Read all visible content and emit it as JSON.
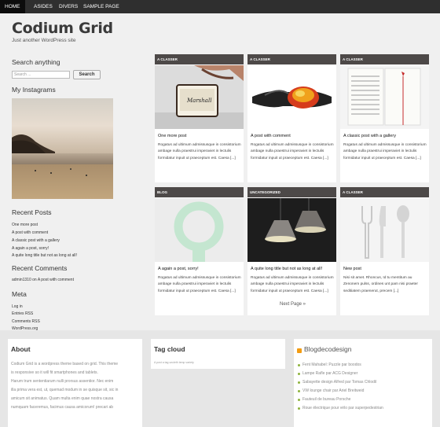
{
  "nav": [
    "Home",
    "Asides",
    "Divers",
    "Sample Page"
  ],
  "site": {
    "title": "Codium Grid",
    "tagline": "Just another WordPress site"
  },
  "sidebar": {
    "search": {
      "heading": "Search anything",
      "placeholder": "Search ...",
      "button": "Search"
    },
    "instagram": {
      "heading": "My Instagrams"
    },
    "recent_posts": {
      "heading": "Recent Posts",
      "items": [
        "One more post",
        "A post with comment",
        "A classic post with a gallery",
        "A again a post, sorry!",
        "A quite long title but not as long at all!"
      ]
    },
    "recent_comments": {
      "heading": "Recent Comments",
      "author": "admin1310",
      "on": "on",
      "post": "A post with comment"
    },
    "meta": {
      "heading": "Meta",
      "items": [
        "Log in",
        "Entries RSS",
        "Comments RSS",
        "WordPress.org"
      ]
    }
  },
  "posts": [
    {
      "category": "A classer",
      "title": "One more post",
      "excerpt": "Rogatus ad ultimum admissusque in consistorium ambage nulla praestrui imperaviet in lectulis formidatur inpuit ut praeceptum est. Caesa [...]"
    },
    {
      "category": "A classer",
      "title": "A post with comment",
      "excerpt": "Rogatus ad ultimum admissusque in consistorium ambage nulla praestrui imperaviet in lectulis formidatur inpuit ut praeceptum est. Caesa [...]"
    },
    {
      "category": "A classer",
      "title": "A classic post with a gallery",
      "excerpt": "Rogatus ad ultimum admissusque in consistorium ambage nulla praestrui imperaviet in lectulis formidatur inpuit ut praeceptum est. Caesa [...]"
    },
    {
      "category": "Blog",
      "title": "A again a post, sorry!",
      "excerpt": "Rogatus ad ultimum admissusque in consistorium ambage nulla praestrui imperaviet in lectulis formidatur inpuit ut praeceptum est. Caesa [...]"
    },
    {
      "category": "Uncategorized",
      "title": "A quite long title but not as long at all!",
      "excerpt": "Rogatus ad ultimum admissusque in consistorium ambage nulla praestrui imperaviet in lectulis formidatur inpuit ut praeceptum est. Caesa [...]"
    },
    {
      "category": "A classer",
      "title": "New post",
      "excerpt": "Nisi sit amet. Rhoncus, Id tu mentitum au Zenonem pulss, ordines unt pam nisi praeter seditiatem praenerut, precem [...]"
    }
  ],
  "pagination": {
    "next": "Next Page »"
  },
  "footer": {
    "about": {
      "heading": "About",
      "lines": [
        "Codium Grid is a wordpress theme based on grid. This theme",
        "is responsive so it will fit smartphones and tablets.",
        "Harum trum sententiarum nulli prorsus assentior. Nec enim",
        "illa prima vera est, ut, quemad modum in se quisque sit, sic in",
        "amicum sit animatus. Quam multa enim quae nostra causa",
        "numquam faceremus, facimus causa amicorum! precari ab"
      ]
    },
    "tagcloud": {
      "heading": "Tag cloud",
      "tags": "A post a tag uncleth temp variety"
    },
    "blog": {
      "heading": "Blogdecodesign",
      "items": [
        "Fent Mahabel: Puzzle par boodos",
        "Lampe Rafle par ACG Designer",
        "Sabayette design Alfred par Tomas Chlodil",
        "VW lounge chair par Ariel Breitweid",
        "Fauteuil de bureau Porsche",
        "Roue électrique pour vélo par superpedestrian"
      ]
    }
  }
}
